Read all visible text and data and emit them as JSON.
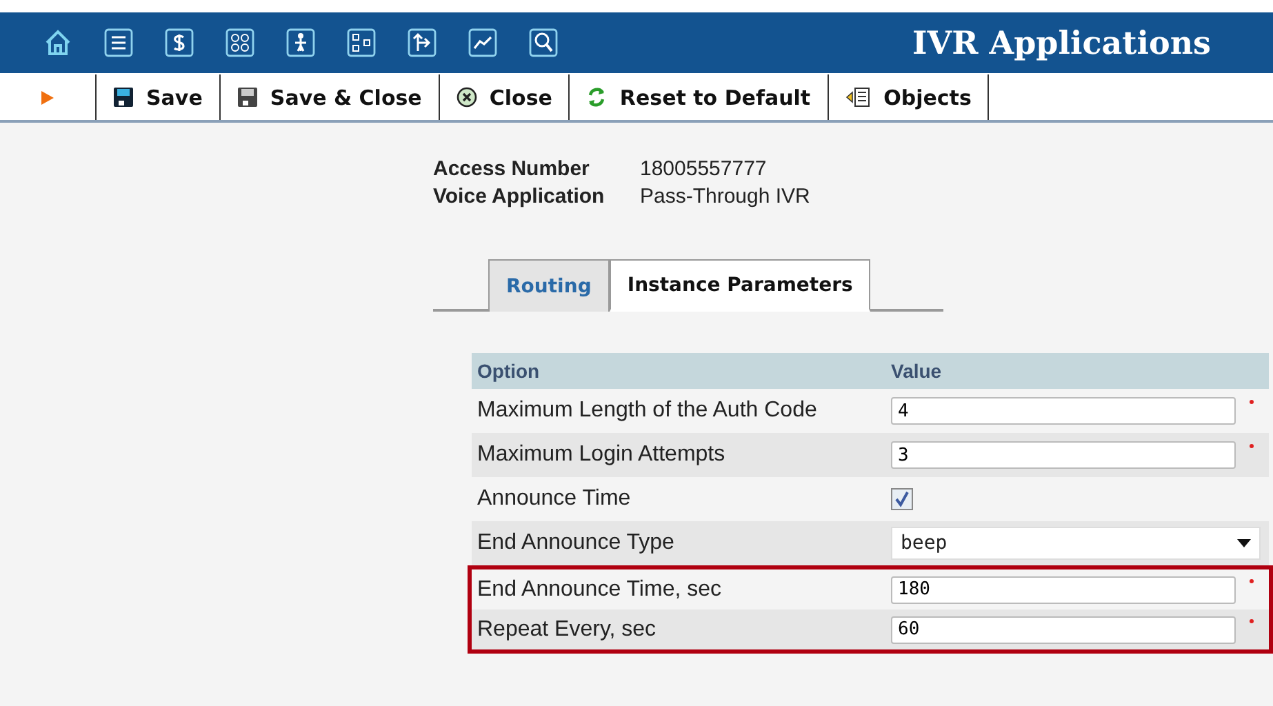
{
  "header": {
    "title": "IVR Applications"
  },
  "toolbar": [
    {
      "kind": "play"
    },
    {
      "kind": "save",
      "label": "Save"
    },
    {
      "kind": "save-close",
      "label": "Save & Close"
    },
    {
      "kind": "close",
      "label": "Close"
    },
    {
      "kind": "reset",
      "label": "Reset to Default"
    },
    {
      "kind": "objects",
      "label": "Objects"
    }
  ],
  "info": [
    {
      "label": "Access Number",
      "value": "18005557777"
    },
    {
      "label": "Voice Application",
      "value": "Pass-Through IVR"
    }
  ],
  "tabs": [
    {
      "label": "Routing",
      "selected": false
    },
    {
      "label": "Instance Parameters",
      "selected": true
    }
  ],
  "table": {
    "columns": [
      "Option",
      "Value"
    ],
    "rows": [
      {
        "kind": "text",
        "label": "Maximum Length of the Auth Code",
        "value": "4",
        "required": true,
        "highlighted": false
      },
      {
        "kind": "text",
        "label": "Maximum Login Attempts",
        "value": "3",
        "required": true,
        "highlighted": false
      },
      {
        "kind": "checkbox",
        "label": "Announce Time",
        "checked": true,
        "highlighted": false
      },
      {
        "kind": "select",
        "label": "End Announce Type",
        "value": "beep",
        "highlighted": false
      },
      {
        "kind": "text",
        "label": "End Announce Time, sec",
        "value": "180",
        "required": true,
        "highlighted": true
      },
      {
        "kind": "text",
        "label": "Repeat Every, sec",
        "value": "60",
        "required": true,
        "highlighted": true
      }
    ]
  }
}
